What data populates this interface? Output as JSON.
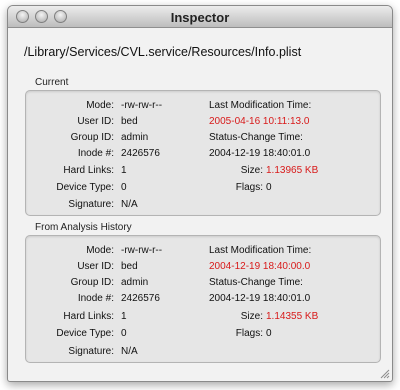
{
  "window": {
    "title": "Inspector"
  },
  "path": "/Library/Services/CVL.service/Resources/Info.plist",
  "current": {
    "label": "Current",
    "mode": {
      "label": "Mode:",
      "value": "-rw-rw-r--"
    },
    "user_id": {
      "label": "User ID:",
      "value": "bed"
    },
    "group_id": {
      "label": "Group ID:",
      "value": "admin"
    },
    "inode": {
      "label": "Inode #:",
      "value": "2426576"
    },
    "hard_links": {
      "label": "Hard Links:",
      "value": "1"
    },
    "device_type": {
      "label": "Device Type:",
      "value": "0"
    },
    "signature": {
      "label": "Signature:",
      "value": "N/A"
    },
    "last_mod": {
      "label": "Last Modification Time:",
      "value": "2005-04-16 10:11:13.0"
    },
    "status_change": {
      "label": "Status-Change Time:",
      "value": "2004-12-19 18:40:01.0"
    },
    "size": {
      "label": "Size:",
      "value": "1.13965 KB"
    },
    "flags": {
      "label": "Flags:",
      "value": "0"
    }
  },
  "history": {
    "label": "From Analysis History",
    "mode": {
      "label": "Mode:",
      "value": "-rw-rw-r--"
    },
    "user_id": {
      "label": "User ID:",
      "value": "bed"
    },
    "group_id": {
      "label": "Group ID:",
      "value": "admin"
    },
    "inode": {
      "label": "Inode #:",
      "value": "2426576"
    },
    "hard_links": {
      "label": "Hard Links:",
      "value": "1"
    },
    "device_type": {
      "label": "Device Type:",
      "value": "0"
    },
    "signature": {
      "label": "Signature:",
      "value": "N/A"
    },
    "last_mod": {
      "label": "Last Modification Time:",
      "value": "2004-12-19 18:40:00.0"
    },
    "status_change": {
      "label": "Status-Change Time:",
      "value": "2004-12-19 18:40:01.0"
    },
    "size": {
      "label": "Size:",
      "value": "1.14355 KB"
    },
    "flags": {
      "label": "Flags:",
      "value": "0"
    }
  },
  "colors": {
    "changed": "#d81a1a"
  }
}
